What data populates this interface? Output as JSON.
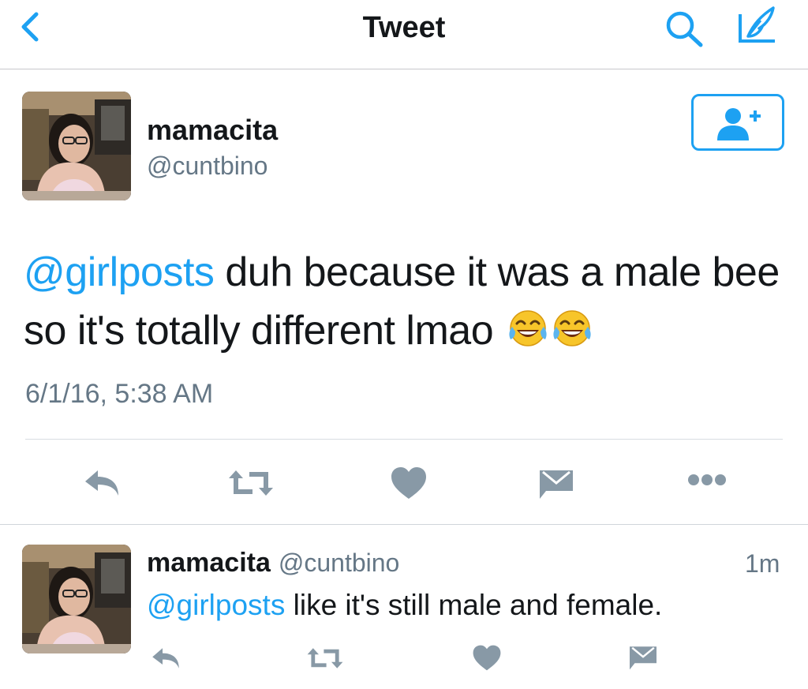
{
  "nav": {
    "title": "Tweet"
  },
  "tweet": {
    "name": "mamacita",
    "handle": "@cuntbino",
    "mention": "@girlposts",
    "text_line1": " duh because it was a male bee",
    "text_line2": "so it's totally different lmao",
    "emoji": [
      "face-with-tears-of-joy",
      "face-with-tears-of-joy"
    ],
    "timestamp": "6/1/16, 5:38 AM"
  },
  "reply": {
    "name": "mamacita",
    "handle": "@cuntbino",
    "time": "1m",
    "mention": "@girlposts",
    "text": " like it's still male and female."
  },
  "colors": {
    "accent": "#1da1f2",
    "icon_gray": "#8899a6",
    "text_secondary": "#657786"
  },
  "icons": {
    "nav": [
      "back-chevron-icon",
      "search-icon",
      "compose-icon"
    ],
    "actions": [
      "reply-icon",
      "retweet-icon",
      "like-icon",
      "direct-message-icon",
      "more-icon"
    ]
  }
}
